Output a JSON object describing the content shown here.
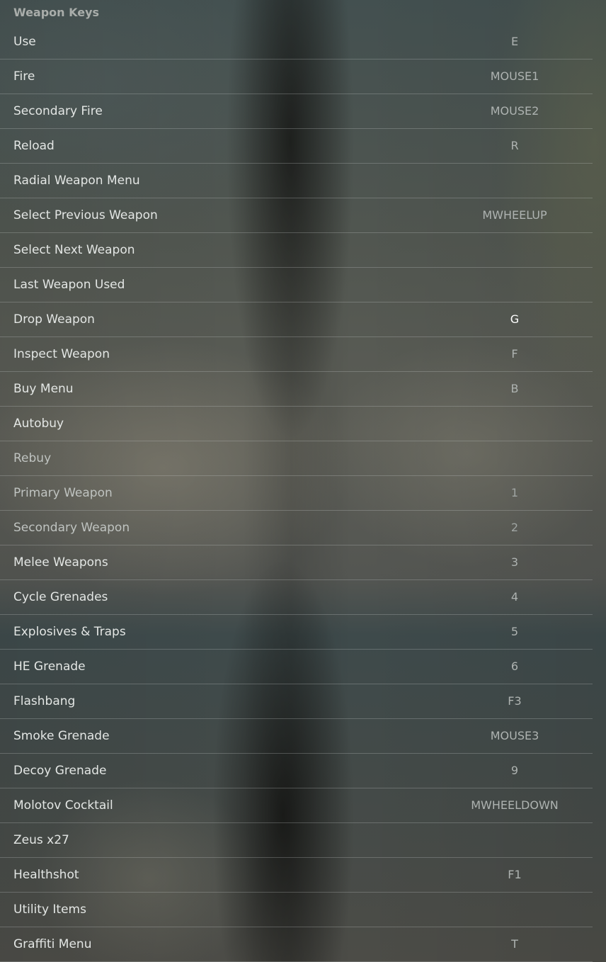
{
  "section": {
    "title": "Weapon Keys"
  },
  "bindings": [
    {
      "action": "Use",
      "key": "E"
    },
    {
      "action": "Fire",
      "key": "MOUSE1"
    },
    {
      "action": "Secondary Fire",
      "key": "MOUSE2"
    },
    {
      "action": "Reload",
      "key": "R"
    },
    {
      "action": "Radial Weapon Menu",
      "key": ""
    },
    {
      "action": "Select Previous Weapon",
      "key": "MWHEELUP"
    },
    {
      "action": "Select Next Weapon",
      "key": ""
    },
    {
      "action": "Last Weapon Used",
      "key": ""
    },
    {
      "action": "Drop Weapon",
      "key": "G"
    },
    {
      "action": "Inspect Weapon",
      "key": "F"
    },
    {
      "action": "Buy Menu",
      "key": "B"
    },
    {
      "action": "Autobuy",
      "key": ""
    },
    {
      "action": "Rebuy",
      "key": ""
    },
    {
      "action": "Primary Weapon",
      "key": "1"
    },
    {
      "action": "Secondary Weapon",
      "key": "2"
    },
    {
      "action": "Melee Weapons",
      "key": "3"
    },
    {
      "action": "Cycle Grenades",
      "key": "4"
    },
    {
      "action": "Explosives & Traps",
      "key": "5"
    },
    {
      "action": "HE Grenade",
      "key": "6"
    },
    {
      "action": "Flashbang",
      "key": "F3"
    },
    {
      "action": "Smoke Grenade",
      "key": "MOUSE3"
    },
    {
      "action": "Decoy Grenade",
      "key": "9"
    },
    {
      "action": "Molotov Cocktail",
      "key": "MWHEELDOWN"
    },
    {
      "action": "Zeus x27",
      "key": ""
    },
    {
      "action": "Healthshot",
      "key": "F1"
    },
    {
      "action": "Utility Items",
      "key": ""
    },
    {
      "action": "Graffiti Menu",
      "key": "T"
    }
  ]
}
